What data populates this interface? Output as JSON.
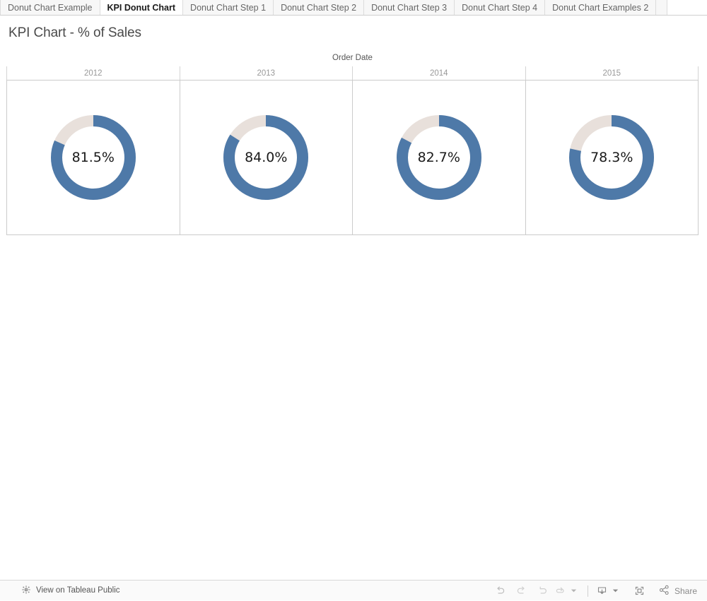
{
  "tabs": [
    {
      "label": "Donut Chart Example",
      "active": false
    },
    {
      "label": "KPI Donut Chart",
      "active": true
    },
    {
      "label": "Donut Chart Step 1",
      "active": false
    },
    {
      "label": "Donut Chart Step 2",
      "active": false
    },
    {
      "label": "Donut Chart Step 3",
      "active": false
    },
    {
      "label": "Donut Chart Step 4",
      "active": false
    },
    {
      "label": "Donut Chart Examples 2",
      "active": false
    },
    {
      "label": "",
      "active": false
    }
  ],
  "viz": {
    "title": "KPI Chart - % of Sales",
    "column_field_label": "Order Date"
  },
  "colors": {
    "value_arc": "#4E79A8",
    "remainder_arc": "#E8E0DB",
    "grid_line": "#cbcbcb",
    "header_text": "#999999",
    "title_text": "#4a4a4a"
  },
  "chart_data": {
    "type": "pie",
    "title": "KPI Chart - % of Sales",
    "subtitle": "",
    "xlabel": "Order Date",
    "ylabel": "",
    "legend_position": "none",
    "grid": false,
    "categories": [
      "2012",
      "2013",
      "2014",
      "2015"
    ],
    "values": [
      81.5,
      84.0,
      82.7,
      78.3
    ],
    "value_labels": [
      "81.5%",
      "84.0%",
      "82.7%",
      "78.3%"
    ],
    "units": "percent",
    "ylim": [
      0,
      100
    ],
    "series": [
      {
        "name": "% of Sales",
        "values": [
          81.5,
          84.0,
          82.7,
          78.3
        ],
        "color": "#4E79A8"
      },
      {
        "name": "Remainder",
        "values": [
          18.5,
          16.0,
          17.3,
          21.7
        ],
        "color": "#E8E0DB"
      }
    ],
    "panels": [
      {
        "category": "2012",
        "value": 81.5,
        "label": "81.5%",
        "remainder": 18.5
      },
      {
        "category": "2013",
        "value": 84.0,
        "label": "84.0%",
        "remainder": 16.0
      },
      {
        "category": "2014",
        "value": 82.7,
        "label": "82.7%",
        "remainder": 17.3
      },
      {
        "category": "2015",
        "value": 78.3,
        "label": "78.3%",
        "remainder": 21.7
      }
    ]
  },
  "toolbar": {
    "tableau_link_label": "View on Tableau Public",
    "undo_label": "Undo",
    "redo_label": "Redo",
    "revert_label": "Revert",
    "refresh_label": "Refresh",
    "download_label": "Download",
    "fullscreen_label": "Full Screen",
    "share_label": "Share"
  }
}
